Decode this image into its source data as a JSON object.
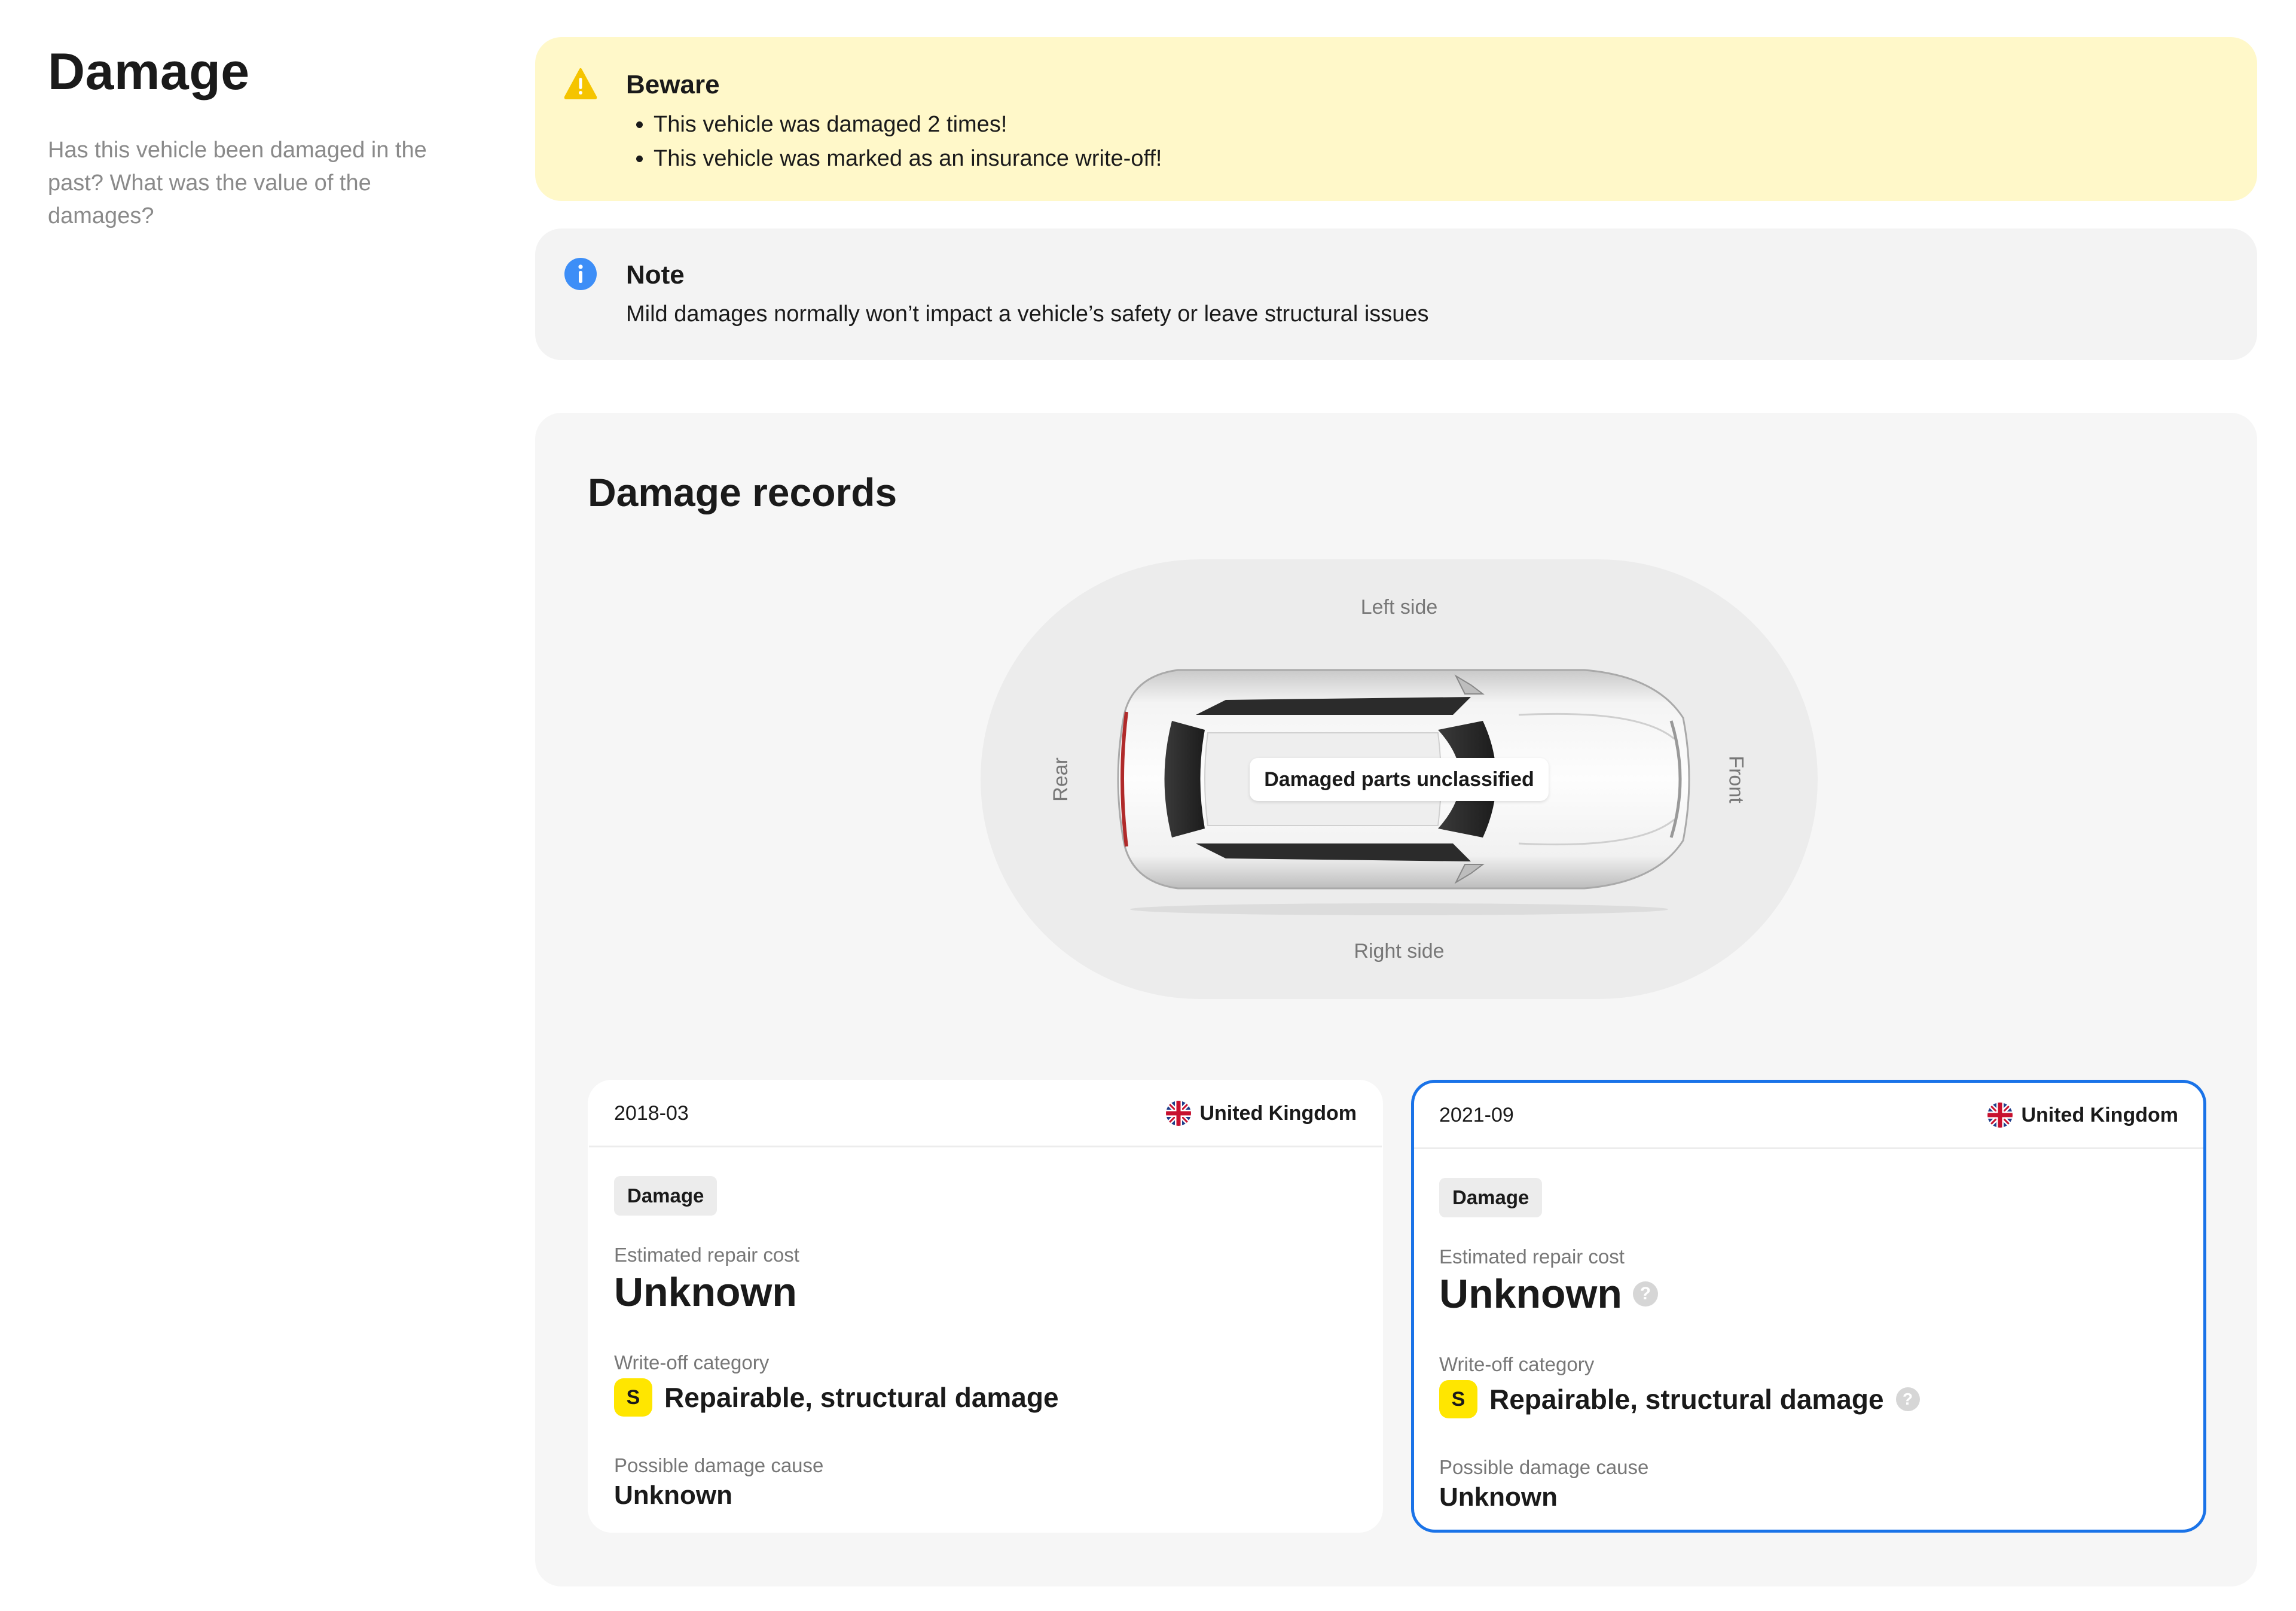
{
  "section": {
    "title": "Damage",
    "description": "Has this vehicle been damaged in the past? What was the value of the damages?"
  },
  "beware": {
    "title": "Beware",
    "items": [
      "This vehicle was damaged 2 times!",
      "This vehicle was marked as an insurance write-off!"
    ],
    "icon": "warning-icon",
    "color": "#f5c400"
  },
  "note": {
    "title": "Note",
    "text": "Mild damages normally won’t impact a vehicle’s safety or leave structural issues",
    "icon": "info-icon",
    "color": "#3d8ef7"
  },
  "records": {
    "title": "Damage records",
    "diagram": {
      "left": "Left side",
      "right": "Right side",
      "rear": "Rear",
      "front": "Front",
      "badge": "Damaged parts unclassified"
    },
    "cards": [
      {
        "date": "2018-03",
        "country": "United Kingdom",
        "tag": "Damage",
        "repair_label": "Estimated repair cost",
        "repair_value": "Unknown",
        "writeoff_label": "Write-off category",
        "writeoff_badge": "S",
        "writeoff_value": "Repairable, structural damage",
        "cause_label": "Possible damage cause",
        "cause_value": "Unknown"
      },
      {
        "date": "2021-09",
        "country": "United Kingdom",
        "tag": "Damage",
        "repair_label": "Estimated repair cost",
        "repair_value": "Unknown",
        "writeoff_label": "Write-off category",
        "writeoff_badge": "S",
        "writeoff_value": "Repairable, structural damage",
        "cause_label": "Possible damage cause",
        "cause_value": "Unknown",
        "help_glyph": "?"
      }
    ],
    "selected_border_color": "#1a73e8",
    "badge_color": "#ffe600"
  }
}
